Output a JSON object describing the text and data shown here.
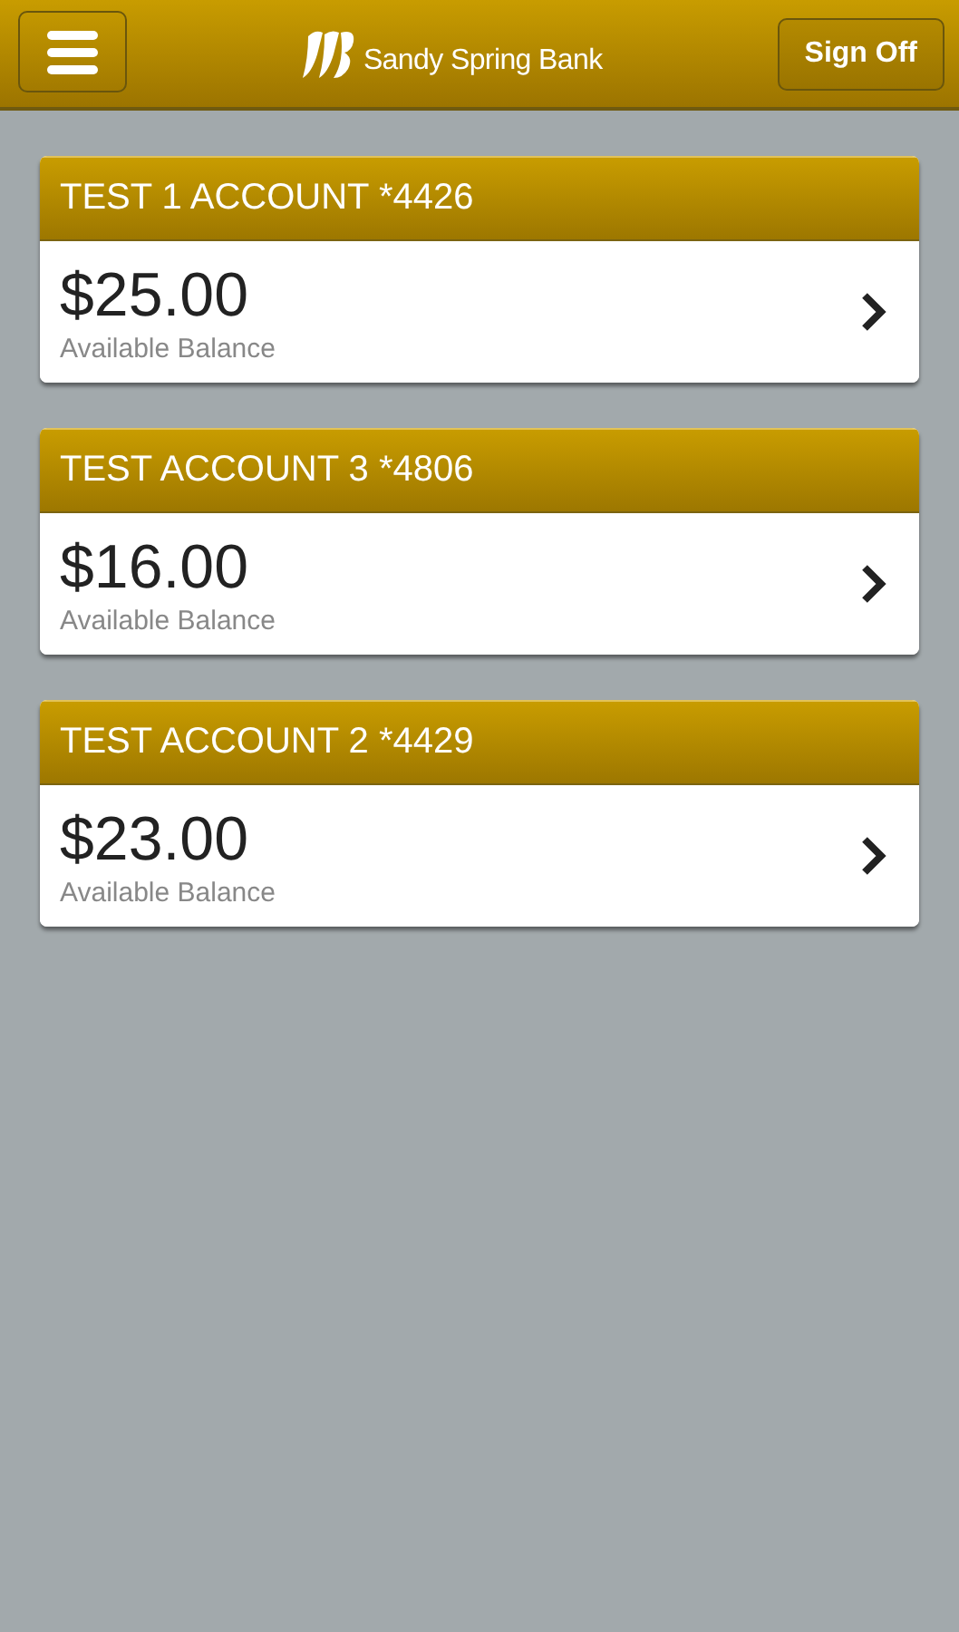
{
  "header": {
    "brand": "Sandy Spring Bank",
    "sign_off": "Sign Off"
  },
  "accounts": [
    {
      "name": "TEST 1 ACCOUNT *4426",
      "balance": "$25.00",
      "balance_label": "Available Balance"
    },
    {
      "name": "TEST ACCOUNT 3 *4806",
      "balance": "$16.00",
      "balance_label": "Available Balance"
    },
    {
      "name": "TEST ACCOUNT 2 *4429",
      "balance": "$23.00",
      "balance_label": "Available Balance"
    }
  ]
}
